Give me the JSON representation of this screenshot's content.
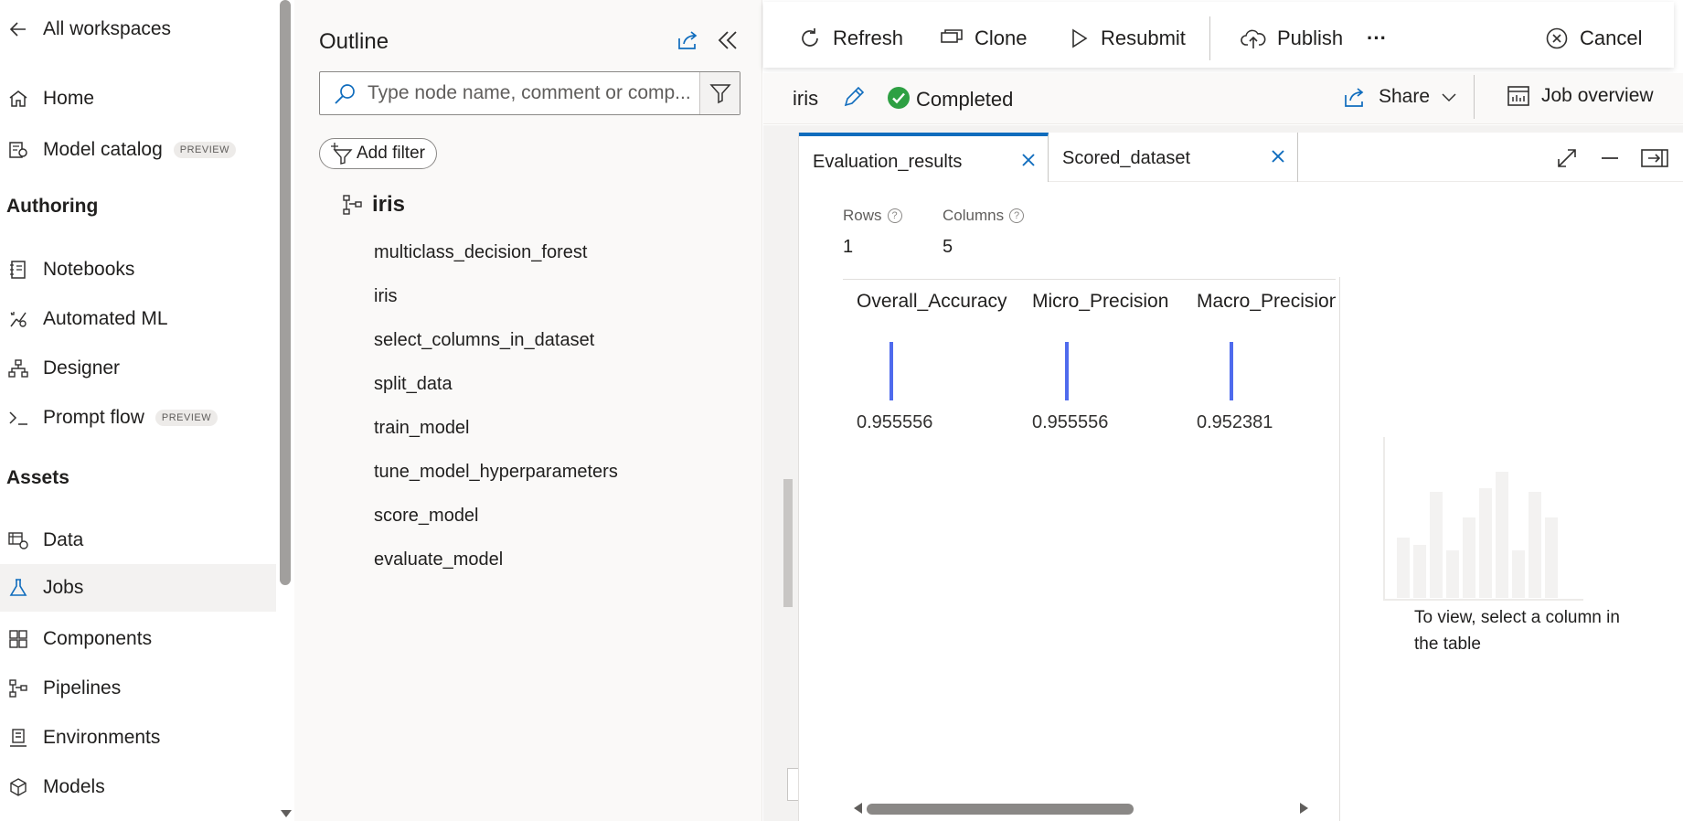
{
  "nav": {
    "back_label": "All workspaces",
    "items_top": [
      {
        "label": "Home",
        "icon": "home-icon"
      },
      {
        "label": "Model catalog",
        "badge": "PREVIEW",
        "icon": "model-catalog-icon"
      }
    ],
    "section_authoring": "Authoring",
    "items_authoring": [
      {
        "label": "Notebooks",
        "icon": "notebook-icon"
      },
      {
        "label": "Automated ML",
        "icon": "automl-icon"
      },
      {
        "label": "Designer",
        "icon": "designer-icon"
      },
      {
        "label": "Prompt flow",
        "badge": "PREVIEW",
        "icon": "prompt-flow-icon"
      }
    ],
    "section_assets": "Assets",
    "items_assets": [
      {
        "label": "Data",
        "icon": "data-icon"
      },
      {
        "label": "Jobs",
        "icon": "jobs-icon",
        "active": true
      },
      {
        "label": "Components",
        "icon": "components-icon"
      },
      {
        "label": "Pipelines",
        "icon": "pipelines-icon"
      },
      {
        "label": "Environments",
        "icon": "environments-icon"
      },
      {
        "label": "Models",
        "icon": "models-icon"
      }
    ]
  },
  "outline": {
    "title": "Outline",
    "search_placeholder": "Type node name, comment or comp...",
    "add_filter_label": "Add filter",
    "root_label": "iris",
    "nodes": [
      "multiclass_decision_forest",
      "iris",
      "select_columns_in_dataset",
      "split_data",
      "train_model",
      "tune_model_hyperparameters",
      "score_model",
      "evaluate_model"
    ]
  },
  "toolbar": {
    "refresh": "Refresh",
    "clone": "Clone",
    "resubmit": "Resubmit",
    "publish": "Publish",
    "more": "···",
    "cancel": "Cancel"
  },
  "job": {
    "name": "iris",
    "status": "Completed",
    "share": "Share",
    "overview": "Job overview",
    "status_color": "#2ea043"
  },
  "results": {
    "tabs": [
      {
        "label": "Evaluation_results",
        "active": true
      },
      {
        "label": "Scored_dataset",
        "active": false
      }
    ],
    "rows_label": "Rows",
    "rows_value": "1",
    "columns_label": "Columns",
    "columns_value": "5",
    "columns": [
      {
        "header": "Overall_Accuracy",
        "value": "0.955556"
      },
      {
        "header": "Micro_Precision",
        "value": "0.955556"
      },
      {
        "header": "Macro_Precision",
        "value": "0.952381"
      }
    ],
    "chart_hint": "To view, select a column in the table",
    "accent_color": "#0f6cbd",
    "bar_color": "#4f6bed"
  }
}
